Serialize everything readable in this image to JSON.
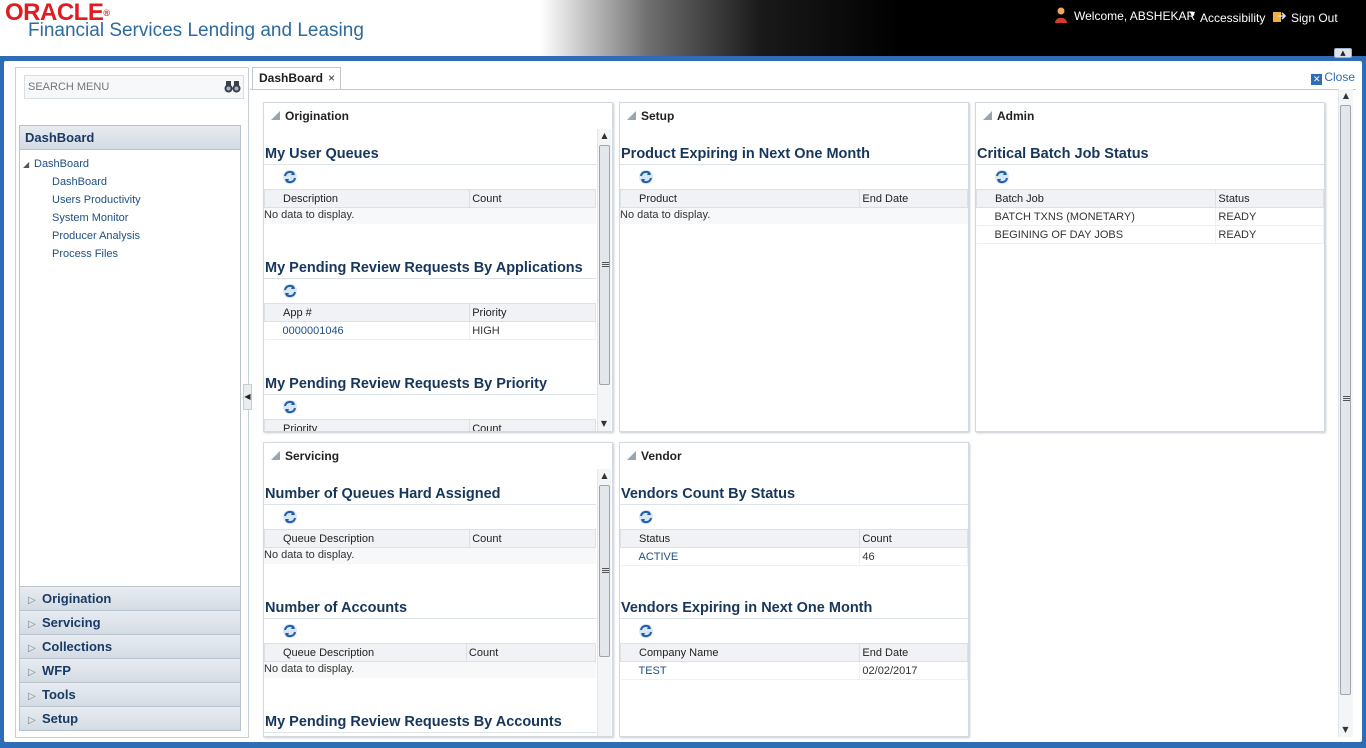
{
  "header": {
    "brand": "ORACLE",
    "app_title": "Financial Services Lending and Leasing",
    "welcome": "Welcome, ABSHEKAR",
    "accessibility": "Accessibility",
    "sign_out": "Sign Out"
  },
  "sidebar": {
    "search_placeholder": "SEARCH MENU",
    "active_section": "DashBoard",
    "tree": {
      "root": "DashBoard",
      "children": [
        "DashBoard",
        "Users Productivity",
        "System Monitor",
        "Producer Analysis",
        "Process Files"
      ]
    },
    "sections": [
      "Origination",
      "Servicing",
      "Collections",
      "WFP",
      "Tools",
      "Setup"
    ]
  },
  "tabs": {
    "active": "DashBoard",
    "close_label": "Close"
  },
  "portlets": {
    "origination": {
      "title": "Origination",
      "user_queues": {
        "title": "My User Queues",
        "columns": [
          "Description",
          "Count"
        ],
        "empty": "No data to display."
      },
      "pending_by_app": {
        "title": "My Pending Review Requests By Applications",
        "columns": [
          "App #",
          "Priority"
        ],
        "rows": [
          [
            "0000001046",
            "HIGH"
          ]
        ]
      },
      "pending_by_priority": {
        "title": "My Pending Review Requests By Priority",
        "columns": [
          "Priority",
          "Count"
        ]
      }
    },
    "setup": {
      "title": "Setup",
      "product_expiring": {
        "title": "Product Expiring in Next One Month",
        "columns": [
          "Product",
          "End Date"
        ],
        "empty": "No data to display."
      }
    },
    "admin": {
      "title": "Admin",
      "batch_status": {
        "title": "Critical Batch Job Status",
        "columns": [
          "Batch Job",
          "Status"
        ],
        "rows": [
          [
            "BATCH TXNS (MONETARY)",
            "READY"
          ],
          [
            "BEGINING OF DAY JOBS",
            "READY"
          ]
        ]
      }
    },
    "servicing": {
      "title": "Servicing",
      "queues_hard": {
        "title": "Number of Queues Hard Assigned",
        "columns": [
          "Queue Description",
          "Count"
        ],
        "empty": "No data to display."
      },
      "accounts": {
        "title": "Number of Accounts",
        "columns": [
          "Queue Description",
          "Count"
        ],
        "empty": "No data to display."
      },
      "pending_by_accounts": {
        "title": "My Pending Review Requests By Accounts"
      }
    },
    "vendor": {
      "title": "Vendor",
      "count_by_status": {
        "title": "Vendors Count By Status",
        "columns": [
          "Status",
          "Count"
        ],
        "rows": [
          [
            "ACTIVE",
            "46"
          ]
        ]
      },
      "expiring": {
        "title": "Vendors Expiring in Next One Month",
        "columns": [
          "Company Name",
          "End Date"
        ],
        "rows": [
          [
            "TEST",
            "02/02/2017"
          ]
        ]
      }
    }
  },
  "colors": {
    "frame_blue": "#2e6cb5",
    "title_blue": "#16365c",
    "oracle_red": "#e01b22"
  }
}
